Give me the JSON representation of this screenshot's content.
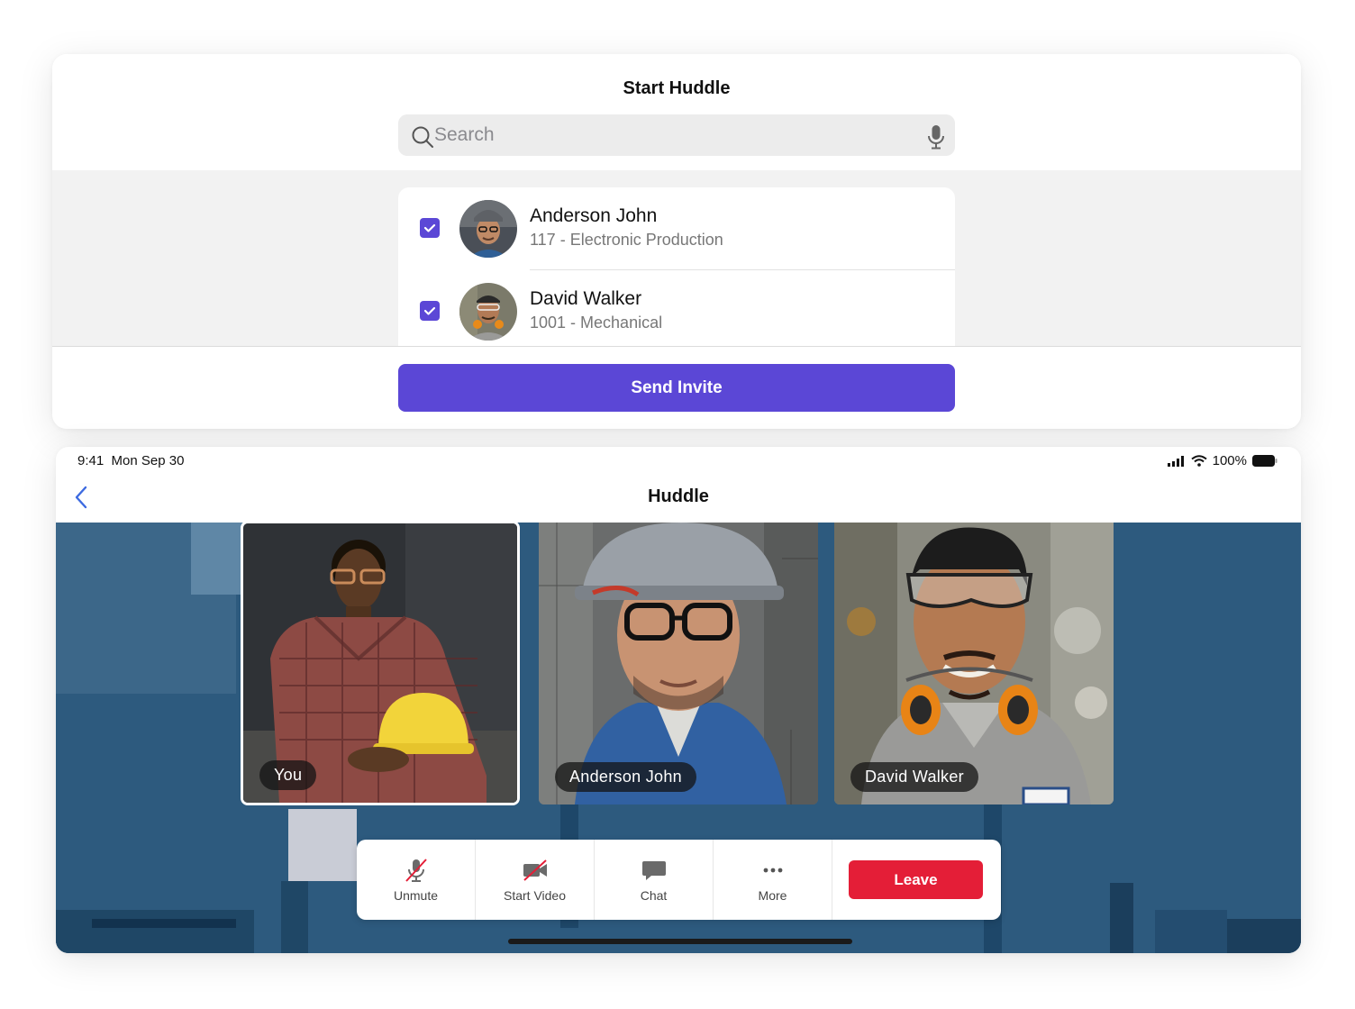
{
  "invite": {
    "title": "Start Huddle",
    "search_placeholder": "Search",
    "contacts": [
      {
        "name": "Anderson John",
        "detail": "117 - Electronic Production",
        "checked": true
      },
      {
        "name": "David Walker",
        "detail": "1001 - Mechanical",
        "checked": true
      }
    ],
    "send_label": "Send Invite"
  },
  "status_bar": {
    "time": "9:41  Mon Sep 30",
    "battery": "100%"
  },
  "huddle": {
    "title": "Huddle",
    "participants": [
      {
        "label": "You"
      },
      {
        "label": "Anderson John"
      },
      {
        "label": "David Walker"
      }
    ],
    "controls": {
      "unmute": "Unmute",
      "start_video": "Start Video",
      "chat": "Chat",
      "more": "More",
      "leave": "Leave"
    }
  },
  "colors": {
    "accent": "#5b47d6",
    "leave": "#e41e37",
    "stage": "#2d5a7e"
  }
}
